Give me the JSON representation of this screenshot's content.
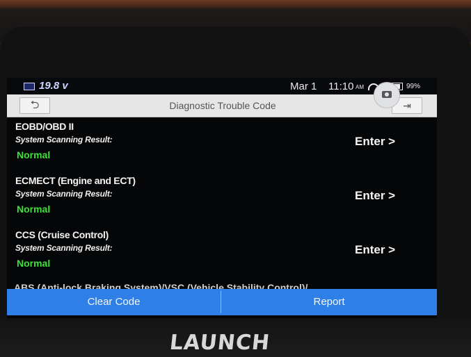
{
  "status_bar": {
    "voltage": "19.8 v",
    "date": "Mar 1",
    "time": "11:10",
    "ampm": "AM",
    "battery_percent": "99%"
  },
  "header": {
    "title": "Diagnostic Trouble Code",
    "back_icon": "back-arrow-icon",
    "exit_icon": "exit-icon"
  },
  "systems": [
    {
      "name": "EOBD/OBD II",
      "scan_label": "System Scanning Result:",
      "status": "Normal",
      "enter_label": "Enter >"
    },
    {
      "name": "ECMECT (Engine and ECT)",
      "scan_label": "System Scanning Result:",
      "status": "Normal",
      "enter_label": "Enter >"
    },
    {
      "name": "CCS (Cruise Control)",
      "scan_label": "System Scanning Result:",
      "status": "Normal",
      "enter_label": "Enter >"
    }
  ],
  "partial_item": "ABS (Anti-lock Braking System)/VSC (Vehicle Stability Control)/",
  "actions": {
    "clear_code": "Clear Code",
    "report": "Report"
  },
  "device": {
    "brand": "LAUNCH"
  },
  "colors": {
    "accent": "#2f7fe8",
    "status_normal": "#3ee03c"
  }
}
